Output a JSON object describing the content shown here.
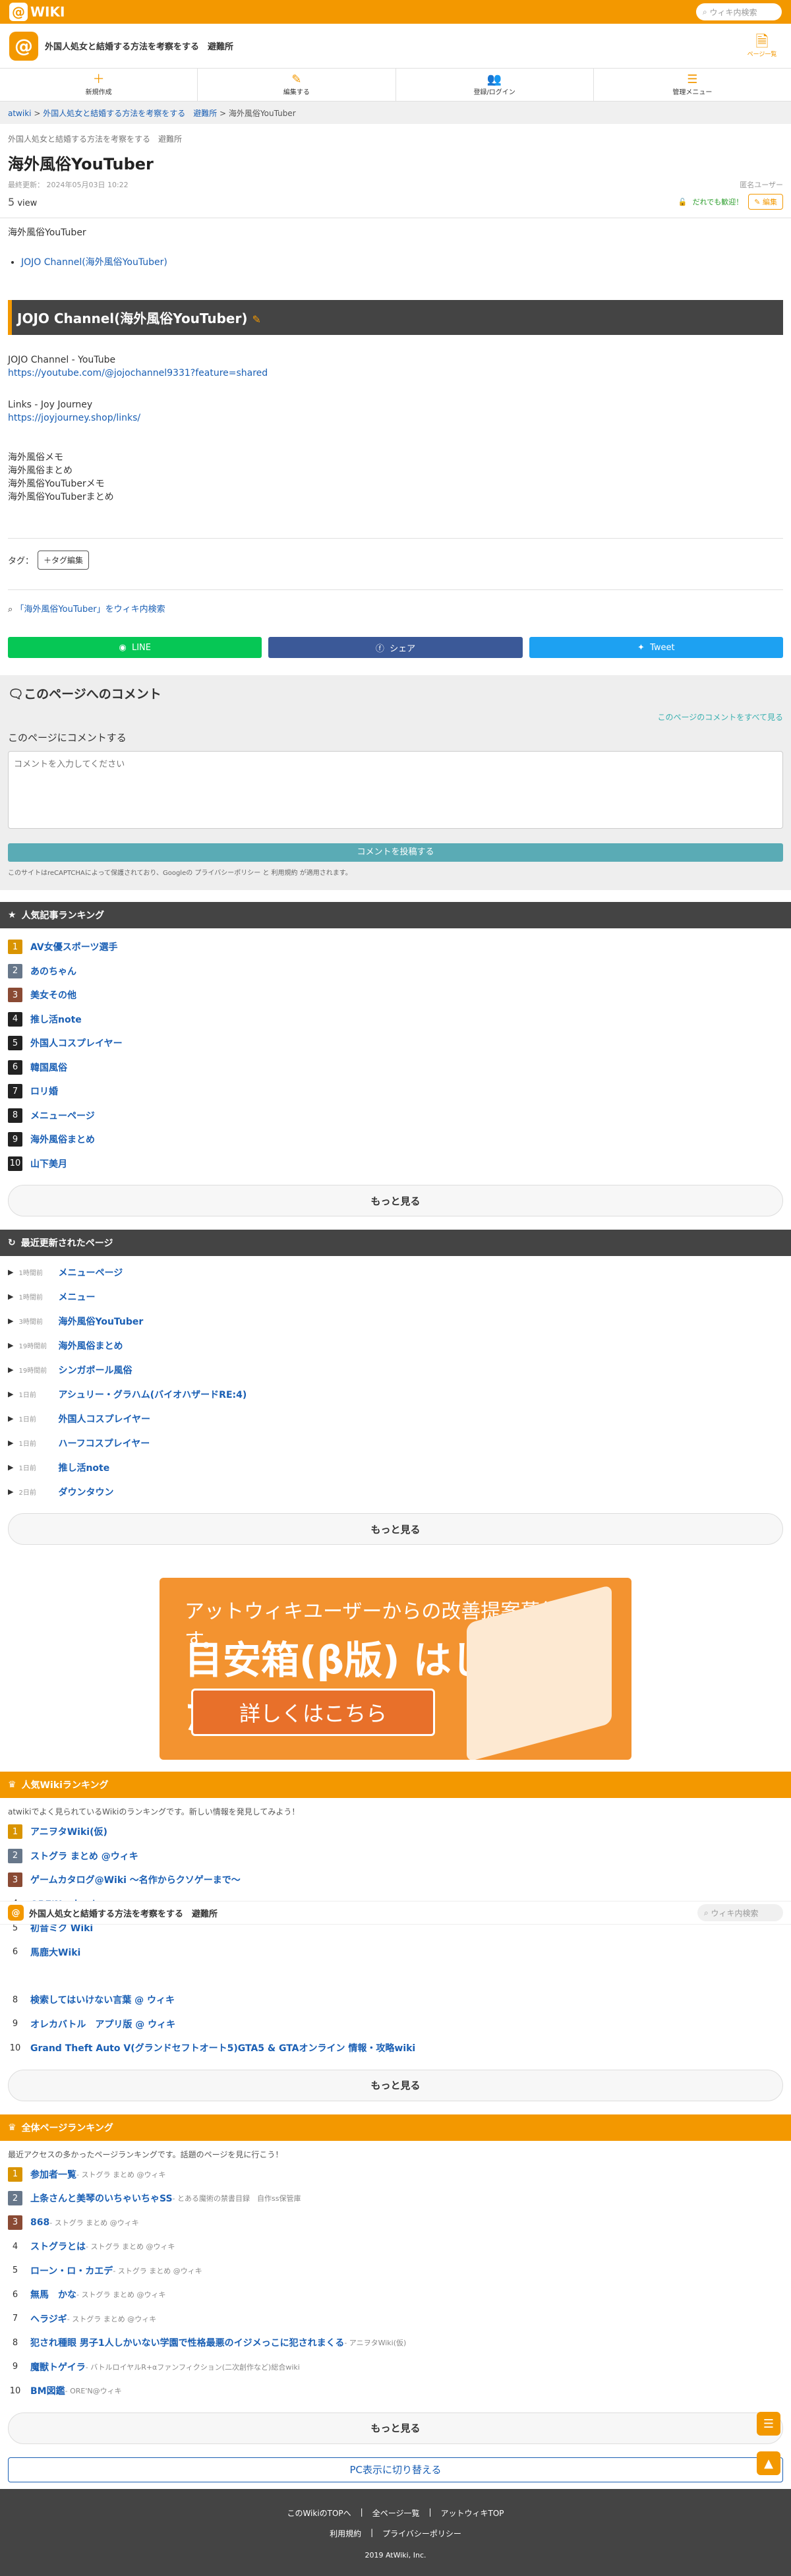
{
  "brand": {
    "logo": "WIKI",
    "search_placeholder": "ウィキ内検索"
  },
  "site": {
    "name": "外国人処女と結婚する方法を考察をする　避難所",
    "page_info": "ページ一覧"
  },
  "menu": [
    "新規作成",
    "編集する",
    "登録/ログイン",
    "管理メニュー"
  ],
  "breadcrumb": {
    "root": "atwiki",
    "site": "外国人処女と結婚する方法を考察をする　避難所",
    "sep": " > ",
    "current": "海外風俗YouTuber"
  },
  "page": {
    "subtitle": "外国人処女と結婚する方法を考察をする　避難所",
    "title": "海外風俗YouTuber",
    "updated": "最終更新： 2024年05月03日 10:22",
    "anon": "匿名ユーザー",
    "views": "5",
    "views_unit": "view",
    "welcome": "だれでも歓迎！",
    "edit": "編集"
  },
  "content": {
    "lead": "海外風俗YouTuber",
    "toc": "JOJO Channel(海外風俗YouTuber)",
    "section": "JOJO Channel(海外風俗YouTuber)",
    "yt_label": "JOJO Channel - YouTube",
    "yt_url": "https://youtube.com/@jojochannel9331?feature=shared",
    "links_label": "Links - Joy Journey",
    "links_url": "https://joyjourney.shop/links/",
    "related": [
      "海外風俗メモ",
      "海外風俗まとめ",
      "海外風俗YouTuberメモ",
      "海外風俗YouTuberまとめ"
    ]
  },
  "tags": {
    "label": "タグ：",
    "button": "＋タグ編集"
  },
  "wiki_search": "「海外風俗YouTuber」をウィキ内検索",
  "share": [
    {
      "label": "LINE",
      "color": "#06c755"
    },
    {
      "label": "シェア",
      "color": "#3b5998"
    },
    {
      "label": "Tweet",
      "color": "#1da1f2"
    }
  ],
  "comments": {
    "title": "このページへのコメント",
    "all": "このページのコメントをすべて見る",
    "label": "このページにコメントする",
    "placeholder": "コメントを入力してください",
    "post": "コメントを投稿する",
    "note": "このサイトはreCAPTCHAによって保護されており、Googleの プライバシーポリシー と 利用規約 が適用されます。"
  },
  "popular": {
    "title": "人気記事ランキング",
    "items": [
      "AV女優スポーツ選手",
      "あのちゃん",
      "美女その他",
      "推し活note",
      "外国人コスプレイヤー",
      "韓国風俗",
      "ロリ婚",
      "メニューページ",
      "海外風俗まとめ",
      "山下美月"
    ],
    "more": "もっと見る"
  },
  "recent": {
    "title": "最近更新されたページ",
    "items": [
      {
        "ago": "1時間前",
        "name": "メニューページ"
      },
      {
        "ago": "1時間前",
        "name": "メニュー"
      },
      {
        "ago": "3時間前",
        "name": "海外風俗YouTuber"
      },
      {
        "ago": "19時間前",
        "name": "海外風俗まとめ"
      },
      {
        "ago": "19時間前",
        "name": "シンガポール風俗"
      },
      {
        "ago": "1日前",
        "name": "アシュリー・グラハム(バイオハザードRE:4)"
      },
      {
        "ago": "1日前",
        "name": "外国人コスプレイヤー"
      },
      {
        "ago": "1日前",
        "name": "ハーフコスプレイヤー"
      },
      {
        "ago": "1日前",
        "name": "推し活note"
      },
      {
        "ago": "2日前",
        "name": "ダウンタウン"
      }
    ],
    "more": "もっと見る"
  },
  "banner": {
    "line1": "アットウィキユーザーからの改善提案募集します。",
    "line2": "目安箱(β版) はじめました。",
    "button": "詳しくはこちら"
  },
  "wiki_rank": {
    "title": "人気Wikiランキング",
    "intro": "atwikiでよく見られているWikiのランキングです。新しい情報を発見してみよう！",
    "items": [
      "アニヲタWiki(仮)",
      "ストグラ まとめ @ウィキ",
      "ゲームカタログ@Wiki ～名作からクソゲーまで～",
      "ORE'N@ウィキ",
      "初音ミク Wiki",
      "馬鹿大Wiki"
    ],
    "items2": [
      "検索してはいけない言葉 @ ウィキ",
      "オレカバトル　アプリ版 @ ウィキ",
      "Grand Theft Auto V(グランドセフトオート5)GTA5 & GTAオンライン 情報・攻略wiki"
    ],
    "more": "もっと見る"
  },
  "all_rank": {
    "title": "全体ページランキング",
    "intro": "最近アクセスの多かったページランキングです。話題のページを見に行こう！",
    "items": [
      {
        "name": "参加者一覧",
        "sub": " - ストグラ まとめ @ウィキ"
      },
      {
        "name": "上条さんと美琴のいちゃいちゃSS",
        "sub": " - とある魔術の禁書目録　自作ss保管庫"
      },
      {
        "name": "868",
        "sub": " - ストグラ まとめ @ウィキ"
      },
      {
        "name": "ストグラとは",
        "sub": " - ストグラ まとめ @ウィキ"
      },
      {
        "name": "ローン・ロ・カエデ",
        "sub": " - ストグラ まとめ @ウィキ"
      },
      {
        "name": "無馬　かな",
        "sub": " - ストグラ まとめ @ウィキ"
      },
      {
        "name": "ヘラジギ",
        "sub": " - ストグラ まとめ @ウィキ"
      },
      {
        "name": "犯され種眼 男子1人しかいない学園で性格最悪のイジメっこに犯されまくる",
        "sub": " - アニヲタWiki(仮)"
      },
      {
        "name": "魔獣トゲイラ",
        "sub": " - バトルロイヤルR+αファンフィクション(二次創作など)総合wiki"
      },
      {
        "name": "BM図鑑",
        "sub": " - ORE'N@ウィキ"
      }
    ],
    "more": "もっと見る"
  },
  "pc_switch": "PC表示に切り替える",
  "footer": {
    "links": [
      "このWikiのTOPへ",
      "全ページ一覧",
      "アットウィキTOP"
    ],
    "links2": [
      "利用規約",
      "プライバシーポリシー"
    ],
    "copy": "2019 AtWiki, Inc."
  }
}
